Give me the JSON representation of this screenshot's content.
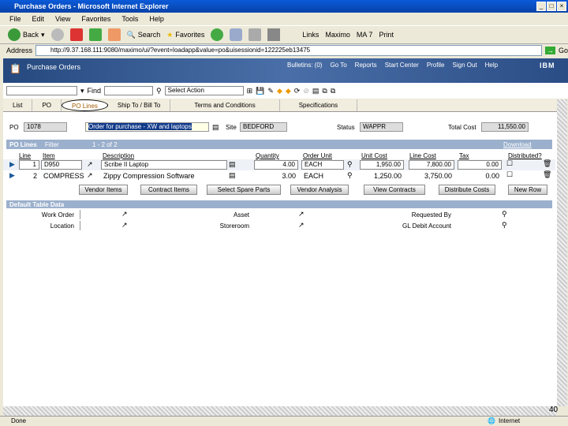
{
  "window": {
    "title": "Purchase Orders - Microsoft Internet Explorer"
  },
  "menu": [
    "File",
    "Edit",
    "View",
    "Favorites",
    "Tools",
    "Help"
  ],
  "toolbar": {
    "back": "Back",
    "search": "Search",
    "favorites": "Favorites",
    "links": "Links",
    "link_items": [
      "Maximo",
      "MA 7",
      "Print"
    ]
  },
  "address": {
    "label": "Address",
    "url": "http://9.37.168.111:9080/maximo/ui/?event=loadapp&value=po&uisessionid=122225eb13475",
    "go": "Go"
  },
  "app": {
    "title": "Purchase Orders",
    "nav": [
      "Bulletins: (0)",
      "Go To",
      "Reports",
      "Start Center",
      "Profile",
      "Sign Out",
      "Help"
    ],
    "find": "Find",
    "select_action": "Select Action"
  },
  "tabs": [
    "List",
    "PO",
    "PO Lines",
    "Ship To / Bill To",
    "Terms and Conditions",
    "Specifications"
  ],
  "header": {
    "po_label": "PO",
    "po": "1078",
    "description": "Order for purchase - XW and laptops",
    "site_label": "Site",
    "site": "BEDFORD",
    "status_label": "Status",
    "status": "WAPPR",
    "total_label": "Total Cost",
    "total": "11,550.00"
  },
  "polines": {
    "title": "PO Lines",
    "filter": "Filter",
    "paging": "1 - 2 of 2",
    "download": "Download",
    "columns": [
      "Line",
      "Item",
      "Description",
      "Quantity",
      "Order Unit",
      "Unit Cost",
      "Line Cost",
      "Tax",
      "Distributed?"
    ],
    "rows": [
      {
        "line": "1",
        "item": "D950",
        "desc": "Scribe II Laptop",
        "qty": "4.00",
        "unit": "EACH",
        "unit_cost": "1,950.00",
        "line_cost": "7,800.00",
        "tax": "0.00"
      },
      {
        "line": "2",
        "item": "COMPRESS",
        "desc": "Zippy Compression Software",
        "qty": "3.00",
        "unit": "EACH",
        "unit_cost": "1,250.00",
        "line_cost": "3,750.00",
        "tax": "0.00"
      }
    ],
    "buttons": [
      "Vendor Items",
      "Contract Items",
      "Select Spare Parts",
      "Vendor Analysis",
      "View Contracts",
      "Distribute Costs",
      "New Row"
    ]
  },
  "details": {
    "title": "Default Table Data",
    "work_order": "Work Order",
    "asset": "Asset",
    "requested_by": "Requested By",
    "location": "Location",
    "storeroom": "Storeroom",
    "gl_debit": "GL Debit Account"
  },
  "statusbar": {
    "text": "Done",
    "zone": "Internet",
    "page": "40"
  }
}
